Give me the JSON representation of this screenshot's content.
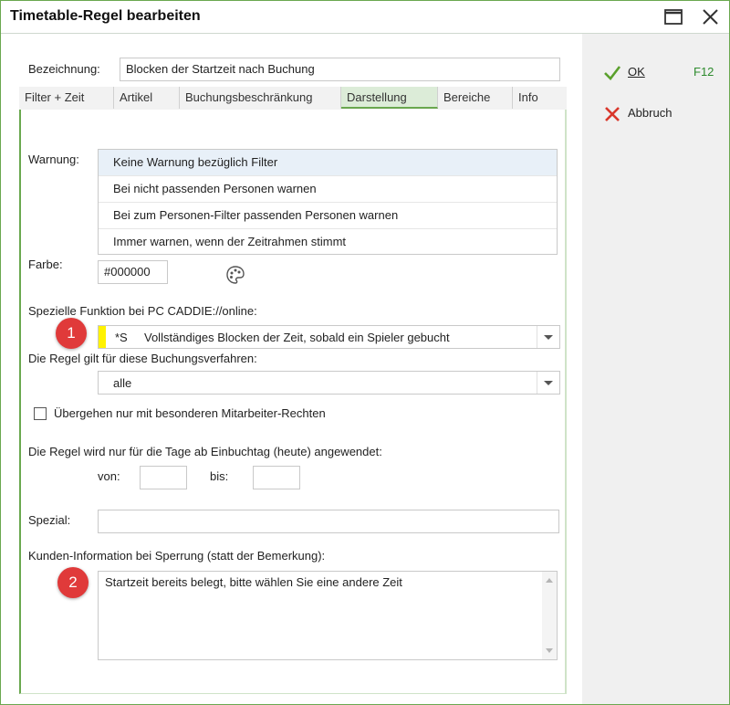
{
  "window": {
    "title": "Timetable-Regel bearbeiten"
  },
  "form": {
    "bezeichnung_label": "Bezeichnung:",
    "bezeichnung_value": "Blocken der Startzeit nach Buchung"
  },
  "tabs": [
    {
      "label": "Filter + Zeit"
    },
    {
      "label": "Artikel"
    },
    {
      "label": "Buchungsbeschränkung"
    },
    {
      "label": "Darstellung"
    },
    {
      "label": "Bereiche"
    },
    {
      "label": "Info"
    }
  ],
  "warnung": {
    "label": "Warnung:",
    "options": [
      "Keine Warnung bezüglich Filter",
      "Bei nicht passenden Personen warnen",
      "Bei zum Personen-Filter passenden Personen warnen",
      "Immer warnen, wenn der Zeitrahmen stimmt"
    ]
  },
  "farbe": {
    "label": "Farbe:",
    "value": "#000000"
  },
  "spezielle": {
    "label": "Spezielle Funktion bei PC CADDIE://online:",
    "code": "*S",
    "value": "Vollständiges Blocken der Zeit, sobald ein Spieler gebucht"
  },
  "verfahren": {
    "label": "Die Regel gilt für diese Buchungsverfahren:",
    "value": "alle"
  },
  "uebergehen": {
    "label": "Übergehen nur mit besonderen Mitarbeiter-Rechten",
    "checked": false
  },
  "tage": {
    "label": "Die Regel wird nur für die Tage ab Einbuchtag (heute) angewendet:",
    "von_label": "von:",
    "bis_label": "bis:",
    "von_value": "",
    "bis_value": ""
  },
  "spezial": {
    "label": "Spezial:",
    "value": ""
  },
  "kunden": {
    "label": "Kunden-Information bei Sperrung (statt der Bemerkung):",
    "value": "Startzeit bereits belegt, bitte wählen Sie eine andere Zeit"
  },
  "badges": [
    "1",
    "2"
  ],
  "actions": {
    "ok_label": "OK",
    "ok_shortcut": "F12",
    "cancel_label": "Abbruch"
  },
  "colors": {
    "accent_green": "#6aa84f",
    "badge_red": "#e03a3a",
    "highlight_yellow": "#fff200"
  }
}
